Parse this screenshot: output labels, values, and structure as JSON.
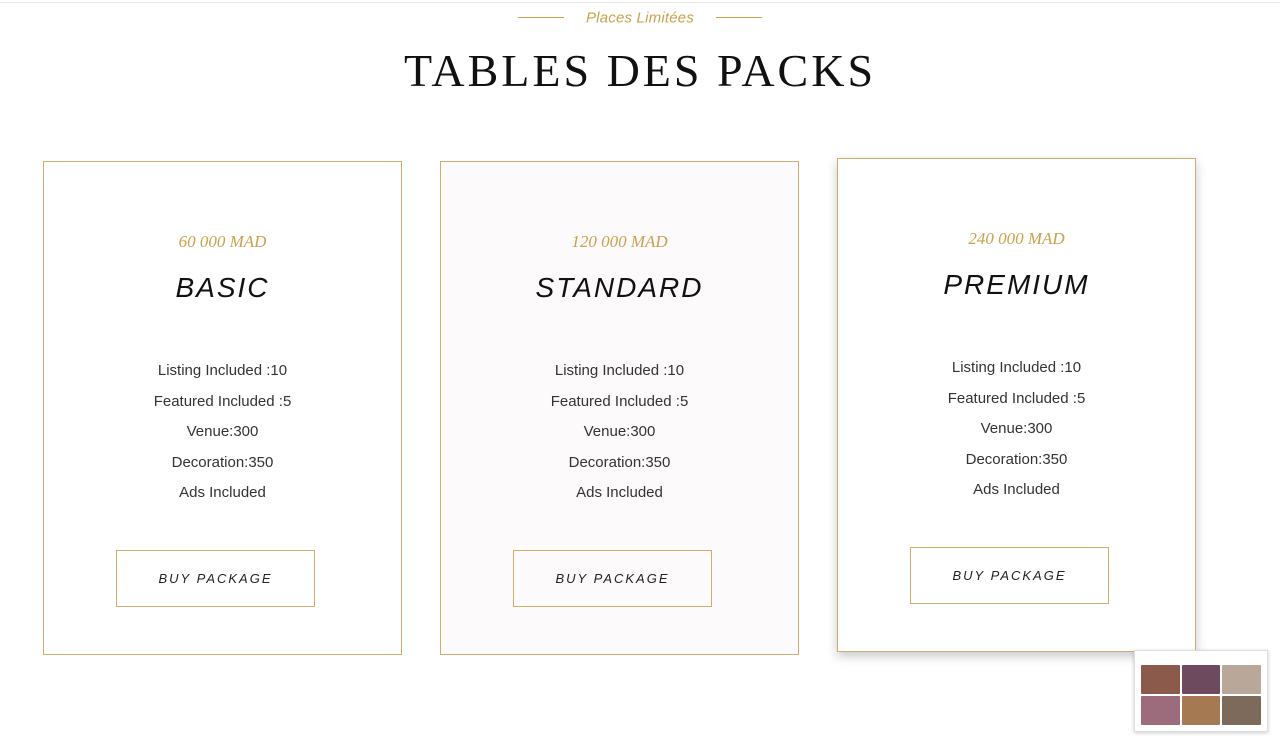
{
  "section": {
    "eyebrow": "Places Limitées",
    "title": "TABLES DES PACKS"
  },
  "packs": [
    {
      "price": "60 000 MAD",
      "name": "BASIC",
      "features": [
        "Listing Included :10",
        "Featured Included :5",
        "Venue:300",
        "Decoration:350",
        "Ads Included"
      ],
      "button": "BUY PACKAGE"
    },
    {
      "price": "120 000 MAD",
      "name": "STANDARD",
      "features": [
        "Listing Included :10",
        "Featured Included :5",
        "Venue:300",
        "Decoration:350",
        "Ads Included"
      ],
      "button": "BUY PACKAGE"
    },
    {
      "price": "240 000 MAD",
      "name": "PREMIUM",
      "features": [
        "Listing Included :10",
        "Featured Included :5",
        "Venue:300",
        "Decoration:350",
        "Ads Included"
      ],
      "button": "BUY PACKAGE"
    }
  ],
  "colors": {
    "accent": "#c9a24a",
    "border": "#cfae6b",
    "text": "#222222"
  },
  "preview_thumbnail": {
    "icon": "page-preview-thumbnail"
  }
}
